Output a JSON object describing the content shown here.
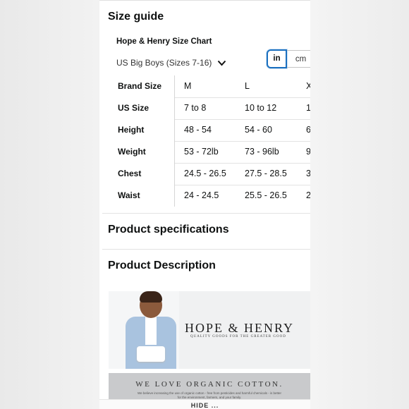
{
  "size_guide": {
    "heading": "Size guide",
    "chart_title": "Hope & Henry Size Chart",
    "size_selector": "US Big Boys (Sizes 7-16)",
    "units": {
      "in": "in",
      "cm": "cm",
      "selected": "in"
    },
    "header": {
      "label": "Brand Size",
      "cols": [
        "M",
        "L",
        "X"
      ]
    },
    "rows": [
      {
        "label": "US Size",
        "values": [
          "7 to 8",
          "10 to 12",
          "1"
        ]
      },
      {
        "label": "Height",
        "values": [
          "48 - 54",
          "54 - 60",
          "6"
        ]
      },
      {
        "label": "Weight",
        "values": [
          "53 - 72lb",
          "73 - 96lb",
          "9"
        ]
      },
      {
        "label": "Chest",
        "values": [
          "24.5 - 26.5",
          "27.5 - 28.5",
          "3"
        ]
      },
      {
        "label": "Waist",
        "values": [
          "24 - 24.5",
          "25.5 - 26.5",
          "2"
        ]
      }
    ]
  },
  "product_specifications": {
    "heading": "Product specifications"
  },
  "product_description": {
    "heading": "Product Description",
    "banner": {
      "brand": "HOPE & HENRY",
      "tagline": "QUALITY GOODS FOR THE GREATER GOOD"
    },
    "banner2": {
      "title": "WE LOVE ORGANIC COTTON.",
      "text": "We believe increasing the use of organic cotton - free from pesticides and harmful chemicals - is better for the environment, farmers, and your family."
    }
  },
  "bottom_bar": {
    "text": "HIDE ..."
  },
  "colors": {
    "accent": "#1a6fbf",
    "text": "#0f1111"
  }
}
